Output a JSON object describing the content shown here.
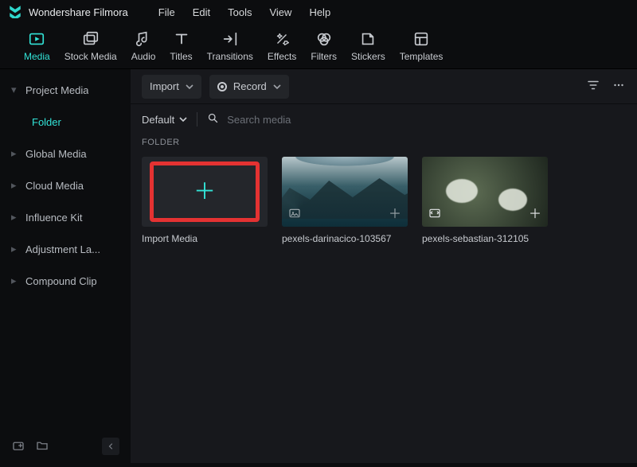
{
  "app": {
    "title": "Wondershare Filmora"
  },
  "menubar": {
    "items": [
      "File",
      "Edit",
      "Tools",
      "View",
      "Help"
    ]
  },
  "toolbar": {
    "items": [
      {
        "id": "media",
        "label": "Media",
        "active": true
      },
      {
        "id": "stock",
        "label": "Stock Media"
      },
      {
        "id": "audio",
        "label": "Audio"
      },
      {
        "id": "titles",
        "label": "Titles"
      },
      {
        "id": "transitions",
        "label": "Transitions"
      },
      {
        "id": "effects",
        "label": "Effects"
      },
      {
        "id": "filters",
        "label": "Filters"
      },
      {
        "id": "stickers",
        "label": "Stickers"
      },
      {
        "id": "templates",
        "label": "Templates"
      }
    ]
  },
  "sidebar": {
    "items": [
      {
        "label": "Project Media",
        "expanded": true,
        "children": [
          {
            "label": "Folder"
          }
        ]
      },
      {
        "label": "Global Media"
      },
      {
        "label": "Cloud Media"
      },
      {
        "label": "Influence Kit"
      },
      {
        "label": "Adjustment La..."
      },
      {
        "label": "Compound Clip"
      }
    ]
  },
  "actions": {
    "import_label": "Import",
    "record_label": "Record"
  },
  "sort": {
    "default_label": "Default"
  },
  "search": {
    "placeholder": "Search media"
  },
  "section": {
    "folder_label": "FOLDER"
  },
  "media": {
    "items": [
      {
        "type": "import",
        "label": "Import Media"
      },
      {
        "type": "image",
        "label": "pexels-darinacico-103567",
        "style": "sea"
      },
      {
        "type": "image",
        "label": "pexels-sebastian-312105",
        "style": "splash"
      }
    ]
  }
}
